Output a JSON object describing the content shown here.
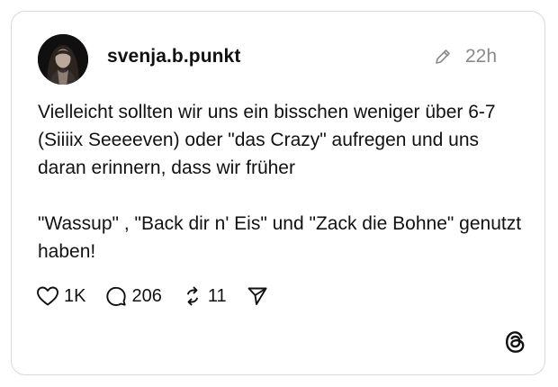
{
  "post": {
    "username": "svenja.b.punkt",
    "timestamp": "22h",
    "paragraphs": [
      "Vielleicht sollten wir uns ein bisschen weniger über 6-7 (Siiiix Seeeeven) oder \"das Crazy\" aufregen und uns daran erinnern, dass wir früher",
      "\"Wassup\" , \"Back dir n' Eis\" und \"Zack die Bohne\" genutzt haben!"
    ]
  },
  "actions": {
    "likes": "1K",
    "replies": "206",
    "reposts": "11"
  },
  "icons": {
    "avatar": "avatar-photo",
    "edit": "pencil-icon",
    "like": "heart-icon",
    "reply": "comment-icon",
    "repost": "repost-icon",
    "share": "send-icon",
    "brand": "threads-logo-icon"
  },
  "colors": {
    "text": "#111111",
    "muted": "#8a8a8a",
    "border": "#d9d9d9",
    "background": "#ffffff"
  }
}
